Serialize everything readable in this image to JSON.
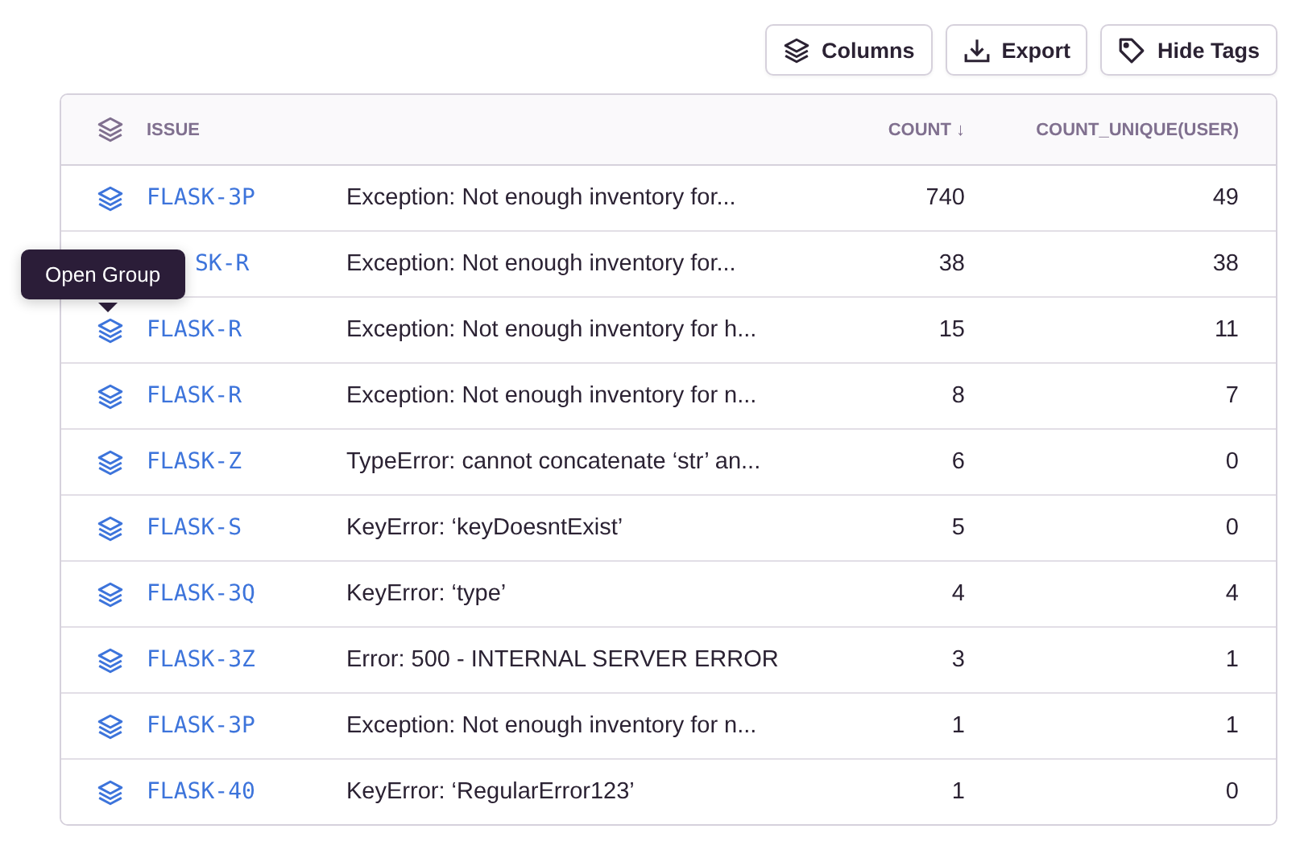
{
  "toolbar": [
    {
      "kind": "columns",
      "label": "Columns"
    },
    {
      "kind": "export",
      "label": "Export"
    },
    {
      "kind": "tag",
      "label": "Hide Tags"
    }
  ],
  "table": {
    "columns": [
      "ISSUE",
      "COUNT",
      "COUNT_UNIQUE(USER)"
    ],
    "sort_arrow": "↓",
    "rows": [
      {
        "issue": "FLASK-3P",
        "title": "Exception: Not enough inventory for...",
        "count": "740",
        "unique": "49",
        "covered": false
      },
      {
        "issue": "SK-R",
        "title": "Exception: Not enough inventory for...",
        "count": "38",
        "unique": "38",
        "covered": true
      },
      {
        "issue": "FLASK-R",
        "title": "Exception: Not enough inventory for h...",
        "count": "15",
        "unique": "11",
        "covered": false
      },
      {
        "issue": "FLASK-R",
        "title": "Exception: Not enough inventory for n...",
        "count": "8",
        "unique": "7",
        "covered": false
      },
      {
        "issue": "FLASK-Z",
        "title": "TypeError: cannot concatenate ‘str’ an...",
        "count": "6",
        "unique": "0",
        "covered": false
      },
      {
        "issue": "FLASK-S",
        "title": "KeyError: ‘keyDoesntExist’",
        "count": "5",
        "unique": "0",
        "covered": false
      },
      {
        "issue": "FLASK-3Q",
        "title": "KeyError: ‘type’",
        "count": "4",
        "unique": "4",
        "covered": false
      },
      {
        "issue": "FLASK-3Z",
        "title": "Error: 500 - INTERNAL SERVER ERROR",
        "count": "3",
        "unique": "1",
        "covered": false
      },
      {
        "issue": "FLASK-3P",
        "title": "Exception: Not enough inventory for n...",
        "count": "1",
        "unique": "1",
        "covered": false
      },
      {
        "issue": "FLASK-40",
        "title": "KeyError: ‘RegularError123’",
        "count": "1",
        "unique": "0",
        "covered": false
      }
    ]
  },
  "tooltip": {
    "text": "Open Group"
  }
}
